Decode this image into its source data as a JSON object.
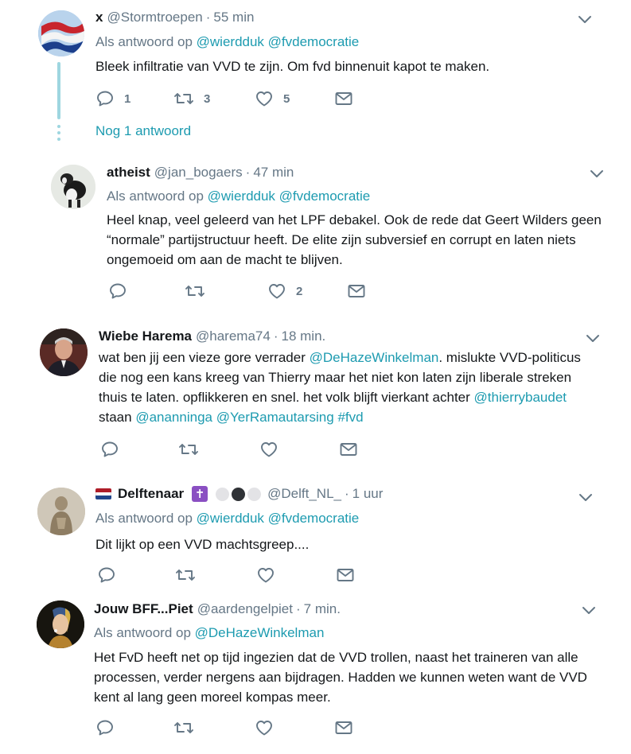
{
  "tweets": [
    {
      "name": "x",
      "handle": "@Stormtroepen",
      "time": "55 min",
      "reply_prefix": "Als antwoord op",
      "reply_to": [
        "@wierdduk",
        "@fvdemocratie"
      ],
      "text": "Bleek infiltratie van VVD te zijn. Om fvd binnenuit kapot te maken.",
      "replies": "1",
      "retweets": "3",
      "likes": "5"
    },
    {
      "name": "atheist",
      "handle": "@jan_bogaers",
      "time": "47 min",
      "reply_prefix": "Als antwoord op",
      "reply_to": [
        "@wierdduk",
        "@fvdemocratie"
      ],
      "text_lines": [
        "Heel knap, veel geleerd van het LPF debakel. Ook de rede dat Geert Wilders geen",
        "“normale” partijstructuur heeft. De elite zijn subversief en corrupt en laten niets",
        "ongemoeid om aan de macht te blijven."
      ],
      "replies": "",
      "retweets": "",
      "likes": "2"
    },
    {
      "name": "Wiebe Harema",
      "handle": "@harema74",
      "time": "18 min.",
      "text_parts": {
        "l1a": "wat ben jij een vieze gore verrader ",
        "l1b": "@DeHazeWinkelman",
        "l1c": ". mislukte VVD-politicus",
        "l2": "die nog een kans kreeg van Thierry maar het niet kon laten zijn liberale streken",
        "l3a": "thuis te laten. opflikkeren en snel. het volk blijft vierkant achter ",
        "l3b": "@thierrybaudet",
        "l4a": "staan ",
        "l4b": "@ananninga",
        "l4c": "@YerRamautarsing",
        "l4d": "#fvd"
      }
    },
    {
      "name": "Delftenaar",
      "name_suffix": "✝",
      "handle": "@Delft_NL_",
      "time": "1 uur",
      "reply_prefix": "Als antwoord op",
      "reply_to": [
        "@wierdduk",
        "@fvdemocratie"
      ],
      "text": "Dit lijkt op een VVD machtsgreep...."
    },
    {
      "name": "Jouw BFF...Piet",
      "handle": "@aardengelpiet",
      "time": "7 min.",
      "reply_prefix": "Als antwoord op",
      "reply_to": [
        "@DeHazeWinkelman"
      ],
      "text_lines": [
        "Het FvD heeft net op tijd ingezien dat de VVD trollen, naast het traineren van alle",
        "processen, verder nergens aan bijdragen. Hadden we kunnen weten want de VVD",
        "kent al lang geen moreel kompas meer."
      ]
    }
  ],
  "more_replies": "Nog 1 antwoord",
  "colors": {
    "link": "#1d9bb0",
    "muted": "#657786",
    "thread": "#9ed6e0"
  }
}
